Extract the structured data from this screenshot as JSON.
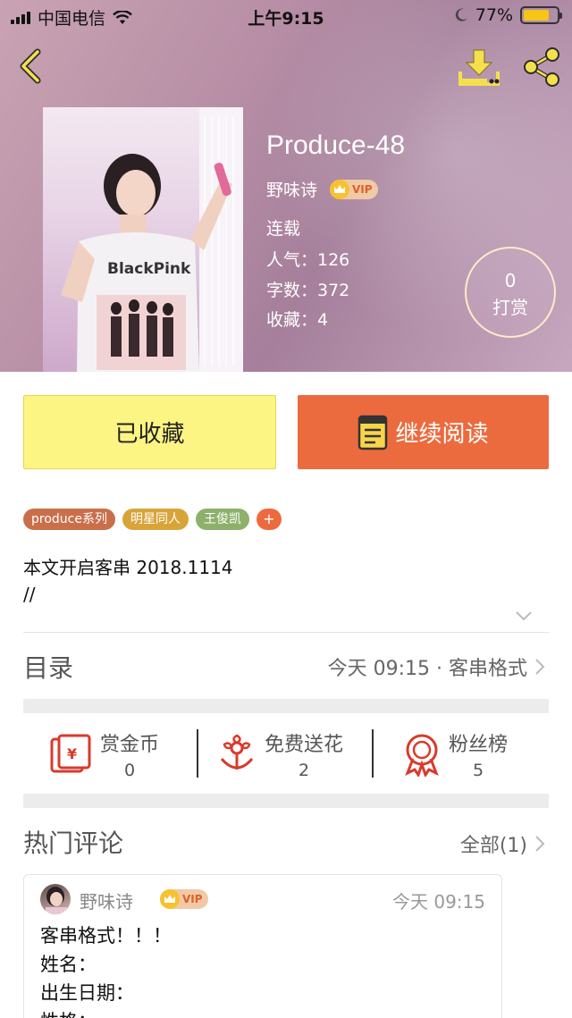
{
  "status_bar": {
    "carrier": "中国电信",
    "time": "上午9:15",
    "battery": "77%",
    "battery_level": 0.77
  },
  "header": {
    "back_icon": "chevron-left-icon",
    "download_icon": "download-icon",
    "share_icon": "share-icon"
  },
  "book": {
    "title": "Produce-48",
    "author": "野味诗",
    "vip_label": "VIP",
    "status": "连载",
    "popularity": "人气：126",
    "word_count": "字数：372",
    "favorites": "收藏：4",
    "cover_text": "BlackPink"
  },
  "reward": {
    "count": "0",
    "label": "打赏"
  },
  "buttons": {
    "collected": "已收藏",
    "continue_reading": "继续阅读"
  },
  "tags": [
    {
      "label": "produce系列",
      "color": "#c96f4a"
    },
    {
      "label": "明星同人",
      "color": "#d8a43a"
    },
    {
      "label": "王俊凯",
      "color": "#8db06a"
    }
  ],
  "tag_add": "+",
  "intro": {
    "line1": "本文开启客串 2018.1114",
    "line2": "//"
  },
  "toc": {
    "label": "目录",
    "latest": "今天 09:15 · 客串格式"
  },
  "stats": [
    {
      "label": "赏金币",
      "value": "0",
      "icon": "red-envelope-icon"
    },
    {
      "label": "免费送花",
      "value": "2",
      "icon": "flower-icon"
    },
    {
      "label": "粉丝榜",
      "value": "5",
      "icon": "medal-icon"
    }
  ],
  "comments": {
    "label": "热门评论",
    "all": "全部(1)",
    "items": [
      {
        "author": "野味诗",
        "vip": "VIP",
        "time": "今天 09:15",
        "lines": [
          "客串格式！！！",
          "姓名：",
          "出生日期：",
          "性格："
        ]
      }
    ]
  },
  "colors": {
    "accent": "#ec6b3e",
    "collected_bg": "#fdf583",
    "reward_ring": "#fff0c8"
  }
}
